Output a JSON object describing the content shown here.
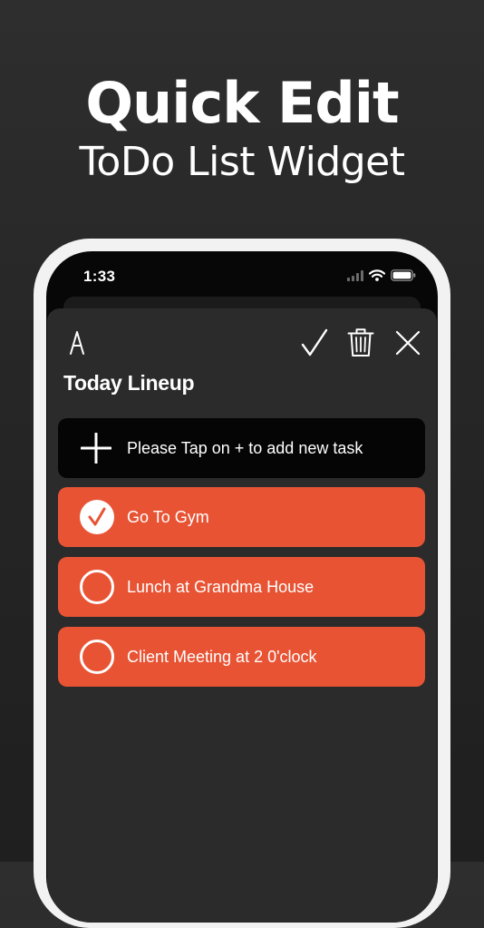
{
  "promo": {
    "headline": "Quick Edit",
    "subheadline": "ToDo List Widget"
  },
  "status_bar": {
    "time": "1:33",
    "icons": [
      "signal-icon",
      "wifi-icon",
      "battery-icon"
    ]
  },
  "toolbar": {
    "icons": [
      "pen-nib-icon",
      "checkmark-icon",
      "trash-icon",
      "close-icon"
    ]
  },
  "list": {
    "title": "Today Lineup",
    "add_hint": "Please Tap on + to add new task",
    "tasks": [
      {
        "label": "Go To Gym",
        "done": true
      },
      {
        "label": "Lunch at Grandma House",
        "done": false
      },
      {
        "label": "Client Meeting at 2 0'clock",
        "done": false
      }
    ]
  },
  "colors": {
    "accent": "#e85334",
    "sheet": "#2b2b2c",
    "add_row": "#050505",
    "background": "#262626"
  }
}
